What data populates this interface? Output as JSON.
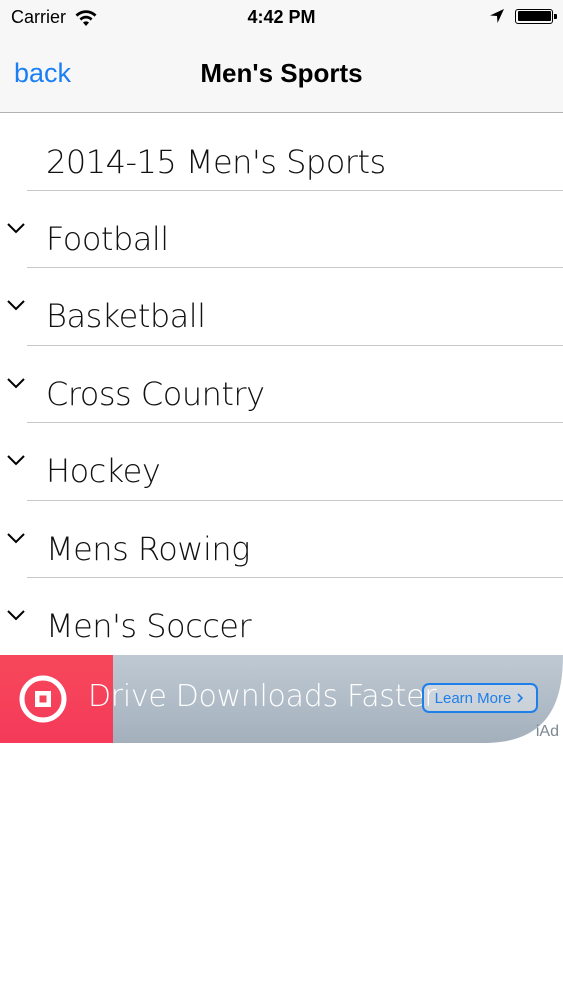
{
  "status_bar": {
    "carrier": "Carrier",
    "time": "4:42 PM",
    "battery_level": 1.0
  },
  "nav": {
    "back_label": "back",
    "title": "Men's Sports"
  },
  "list": {
    "header": "2014-15 Men's Sports",
    "items": [
      {
        "label": "Football",
        "icon": "chevron-down-icon"
      },
      {
        "label": "Basketball",
        "icon": "chevron-down-icon"
      },
      {
        "label": "Cross Country",
        "icon": "chevron-down-icon"
      },
      {
        "label": "Hockey",
        "icon": "chevron-down-icon"
      },
      {
        "label": "Mens Rowing",
        "icon": "chevron-down-icon"
      },
      {
        "label": "Men's Soccer",
        "icon": "chevron-down-icon"
      }
    ]
  },
  "ad": {
    "text": "Drive Downloads Faster",
    "button_label": "Learn More",
    "badge": "iAd",
    "colors": {
      "accent": "#f5455a",
      "button": "#1f7fe8"
    }
  },
  "colors": {
    "tint": "#1a7ff5"
  }
}
